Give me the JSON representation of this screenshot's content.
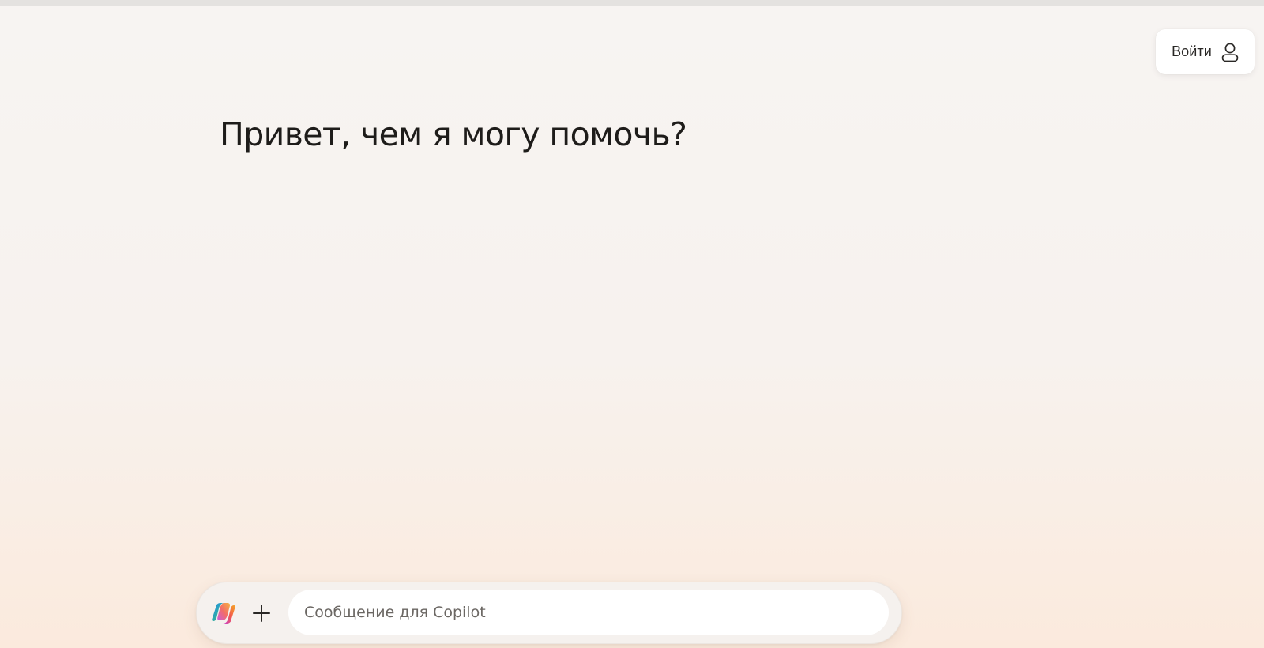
{
  "header": {
    "signin_label": "Войти",
    "signin_icon": "user-icon"
  },
  "main": {
    "greeting": "Привет, чем я могу помочь?"
  },
  "composer": {
    "logo_icon": "copilot-logo-icon",
    "add_icon": "plus-icon",
    "input_value": "",
    "input_placeholder": "Сообщение для Copilot"
  },
  "colors": {
    "background_top": "#f7f4f2",
    "background_bottom": "#fbeadd",
    "text": "#1e1c1a",
    "input_bg": "#ffffff",
    "composer_bg": "#f5f1ee"
  }
}
